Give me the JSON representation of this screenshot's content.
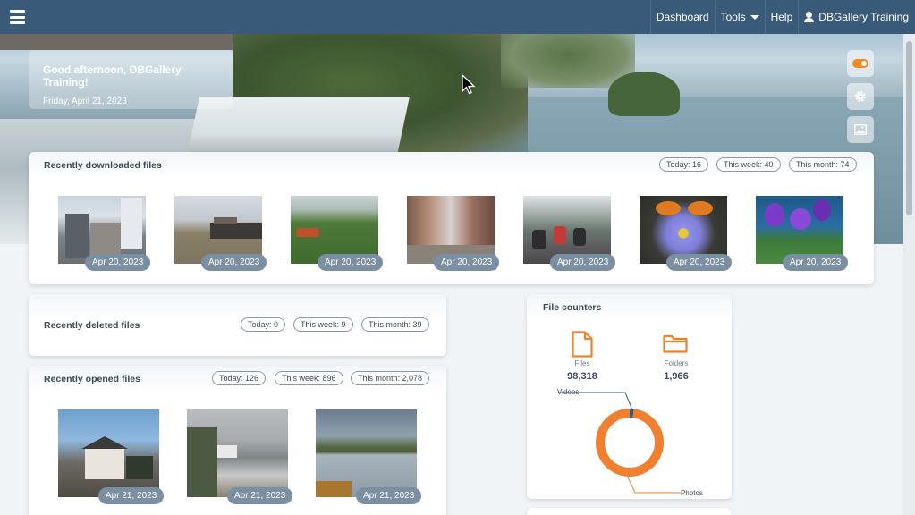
{
  "nav": {
    "dashboard": "Dashboard",
    "tools": "Tools",
    "help": "Help",
    "user": "DBGallery Training"
  },
  "greeting": {
    "title": "Good afternoon, DBGallery Training!",
    "date": "Friday, April 21, 2023"
  },
  "downloaded": {
    "title": "Recently downloaded files",
    "today": "Today: 16",
    "week": "This week: 40",
    "month": "This month: 74",
    "items": [
      {
        "date": "Apr 20, 2023",
        "scene": "construction-site"
      },
      {
        "date": "Apr 20, 2023",
        "scene": "river-boat"
      },
      {
        "date": "Apr 20, 2023",
        "scene": "water-hyacinth-boat"
      },
      {
        "date": "Apr 20, 2023",
        "scene": "street-market"
      },
      {
        "date": "Apr 20, 2023",
        "scene": "scooter-traffic"
      },
      {
        "date": "Apr 20, 2023",
        "scene": "butterfly-aster"
      },
      {
        "date": "Apr 20, 2023",
        "scene": "purple-irises"
      }
    ]
  },
  "deleted": {
    "title": "Recently deleted files",
    "today": "Today: 0",
    "week": "This week: 9",
    "month": "This month: 39"
  },
  "opened": {
    "title": "Recently opened files",
    "today": "Today: 126",
    "week": "This week: 896",
    "month": "This month: 2,078",
    "items": [
      {
        "date": "Apr 21, 2023",
        "scene": "house-by-sea"
      },
      {
        "date": "Apr 21, 2023",
        "scene": "rocky-shore"
      },
      {
        "date": "Apr 21, 2023",
        "scene": "calm-lake-hills"
      }
    ]
  },
  "counters": {
    "title": "File counters",
    "files_label": "Files",
    "files_value": "98,318",
    "folders_label": "Folders",
    "folders_value": "1,966",
    "videos_label": "Videos",
    "photos_label": "Photos"
  },
  "chart_data": {
    "type": "pie",
    "categories": [
      "Videos",
      "Photos"
    ],
    "values": [
      2,
      98
    ],
    "colors": [
      "#3a5a7a",
      "#f08030"
    ]
  },
  "colors": {
    "topbar": "#3a5a7a",
    "accent": "#f28a26",
    "badge": "#7a8fa1"
  }
}
